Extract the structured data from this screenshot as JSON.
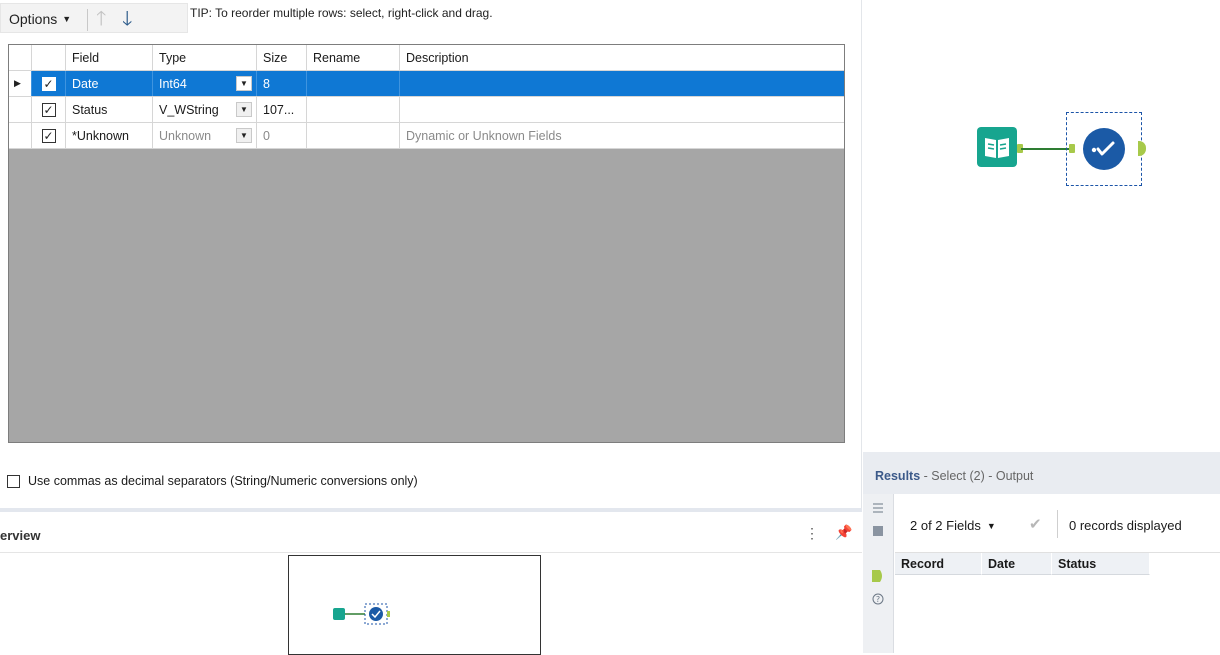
{
  "toolbar": {
    "options_label": "Options",
    "tip": "TIP: To reorder multiple rows: select, right-click and drag."
  },
  "grid": {
    "headers": [
      "Field",
      "Type",
      "Size",
      "Rename",
      "Description"
    ],
    "rows": [
      {
        "checked": true,
        "field": "Date",
        "type": "Int64",
        "size": "8",
        "rename": "",
        "description": "",
        "selected": true
      },
      {
        "checked": true,
        "field": "Status",
        "type": "V_WString",
        "size": "107...",
        "rename": "",
        "description": "",
        "selected": false
      },
      {
        "checked": true,
        "field": "*Unknown",
        "type": "Unknown",
        "size": "0",
        "rename": "",
        "description": "Dynamic or Unknown Fields",
        "selected": false
      }
    ]
  },
  "options": {
    "commas_label": "Use commas as decimal separators (String/Numeric conversions only)",
    "commas_checked": false
  },
  "overview": {
    "title": "erview"
  },
  "results": {
    "title_prefix": "Results",
    "title_suffix": " - Select (2) - Output",
    "fields_label": "2 of 2 Fields",
    "records_label": "0 records displayed",
    "columns": [
      "Record",
      "Date",
      "Status"
    ]
  },
  "colors": {
    "selection": "#0f78d4",
    "input_tool": "#17a58f",
    "select_tool": "#1b5aa6",
    "anchor": "#a7c94a"
  }
}
